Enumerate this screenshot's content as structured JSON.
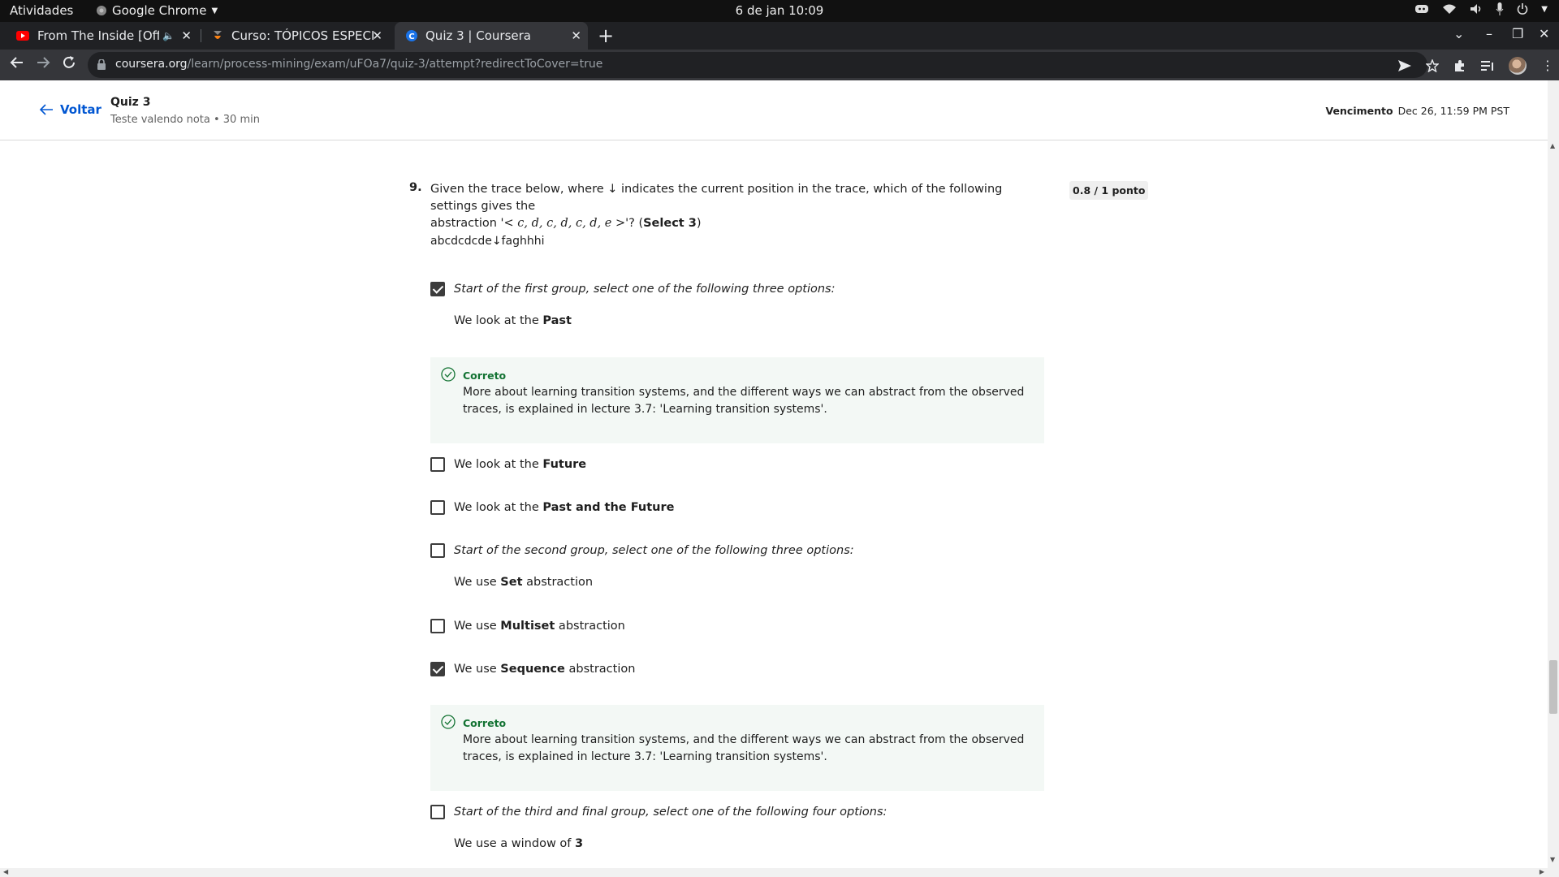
{
  "os_bar": {
    "activities": "Atividades",
    "app_name": "Google Chrome",
    "clock": "6 de jan  10:09"
  },
  "tabs": [
    {
      "title": "From The Inside [Offici",
      "icon": "youtube-icon",
      "audio": true
    },
    {
      "title": "Curso: TÓPICOS ESPECIAI",
      "icon": "moodle-icon"
    },
    {
      "title": "Quiz 3 | Coursera",
      "icon": "coursera-icon",
      "active": true
    }
  ],
  "address": {
    "host": "coursera.org",
    "path": "/learn/process-mining/exam/uFOa7/quiz-3/attempt?redirectToCover=true"
  },
  "header": {
    "back_label": "Voltar",
    "quiz_title": "Quiz 3",
    "quiz_subtitle": "Teste valendo nota • 30 min",
    "due_label": "Vencimento",
    "due_value": "Dec 26, 11:59 PM PST"
  },
  "question": {
    "number": "9.",
    "text_line1": "Given the trace below, where ↓ indicates the current position in the trace, which of the following settings gives the",
    "text_line2_pre": "abstraction '",
    "text_line2_math": "< c, d, c, d, c, d, e >",
    "text_line2_post": "'? (",
    "text_line2_bold": "Select 3",
    "text_line2_end": ")",
    "score": "0.8 / 1 ponto",
    "trace": "abcdcdcde↓faghhhi"
  },
  "options": {
    "group1": {
      "text": "Start of the first group, select one of the following three options:",
      "checked": true
    },
    "past": {
      "pre": "We look at the ",
      "bold": "Past",
      "post": ""
    },
    "future": {
      "pre": "We look at the ",
      "bold": "Future",
      "post": "",
      "checked": false
    },
    "past_future": {
      "pre": "We look at the ",
      "bold": "Past and the Future",
      "post": "",
      "checked": false
    },
    "group2": {
      "text": "Start of the second group, select one of the following three options:",
      "checked": false
    },
    "set": {
      "pre": "We use ",
      "bold": "Set",
      "post": " abstraction"
    },
    "multiset": {
      "pre": "We use ",
      "bold": "Multiset",
      "post": " abstraction",
      "checked": false
    },
    "sequence": {
      "pre": "We use ",
      "bold": "Sequence",
      "post": " abstraction",
      "checked": true
    },
    "group3": {
      "text": "Start of the third and final group, select one of the following four options:",
      "checked": false
    },
    "window3": {
      "pre": "We use a window of ",
      "bold": "3",
      "post": ""
    }
  },
  "feedback": {
    "label": "Correto",
    "text": "More about learning transition systems, and the different ways we can abstract from the observed traces, is explained in lecture 3.7: 'Learning transition systems'.",
    "color": "#137333"
  },
  "colors": {
    "link": "#0056d2",
    "feedback_bg": "#f3f8f5"
  }
}
